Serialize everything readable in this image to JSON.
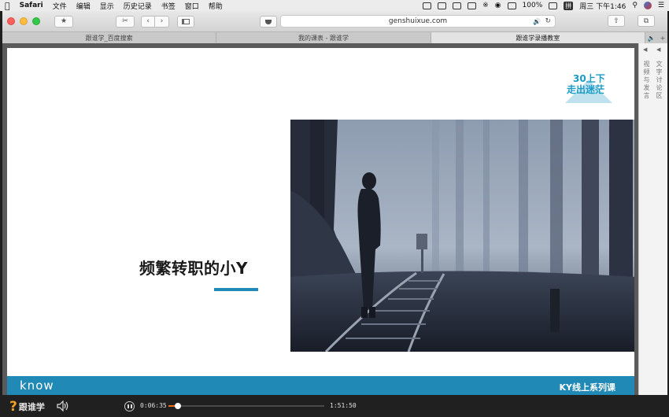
{
  "menubar": {
    "apple": "",
    "app_name": "Safari",
    "items": [
      "文件",
      "编辑",
      "显示",
      "历史记录",
      "书签",
      "窗口",
      "帮助"
    ],
    "battery": "100%",
    "input_method": "拼",
    "clock": "周三 下午1:46"
  },
  "toolbar": {
    "address": "genshuixue.com"
  },
  "tabs": [
    {
      "label": "跟谁学_百度搜索"
    },
    {
      "label": "我的课表 - 跟谁学"
    },
    {
      "label": "跟谁学录播教室"
    }
  ],
  "slide": {
    "badge_line1": "30上下",
    "badge_line2": "走出迷茫",
    "title": "频繁转职的小Y",
    "footer_brand": "know",
    "footer_series": "KY线上系列课"
  },
  "sidepanel": {
    "col1": "视频与发言",
    "col2": "文字讨论区"
  },
  "player": {
    "brand": "跟谁学",
    "current_time": "0:06:35",
    "total_time": "1:51:50",
    "progress": 0.059
  },
  "colors": {
    "accent_blue": "#2189b5",
    "progress_orange": "#f26b1d",
    "logo_orange": "#f3a21b"
  }
}
